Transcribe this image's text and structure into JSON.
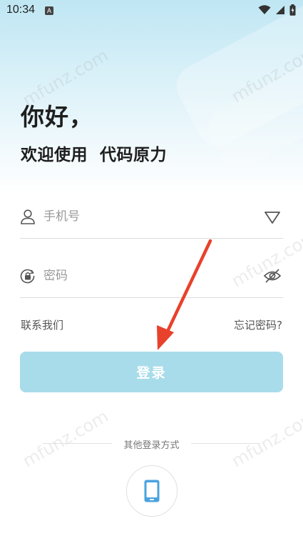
{
  "status_bar": {
    "time": "10:34",
    "indicator": "A"
  },
  "header": {
    "greeting": "你好，",
    "subtitle": "欢迎使用  代码原力"
  },
  "form": {
    "phone_placeholder": "手机号",
    "password_placeholder": "密码"
  },
  "links": {
    "contact": "联系我们",
    "forgot": "忘记密码?"
  },
  "login_button": "登录",
  "other_login": {
    "label": "其他登录方式"
  },
  "watermark": "mfunz.com",
  "colors": {
    "accent": "#a8dcea",
    "phone_icon": "#4aa3df",
    "arrow": "#e8412c"
  }
}
